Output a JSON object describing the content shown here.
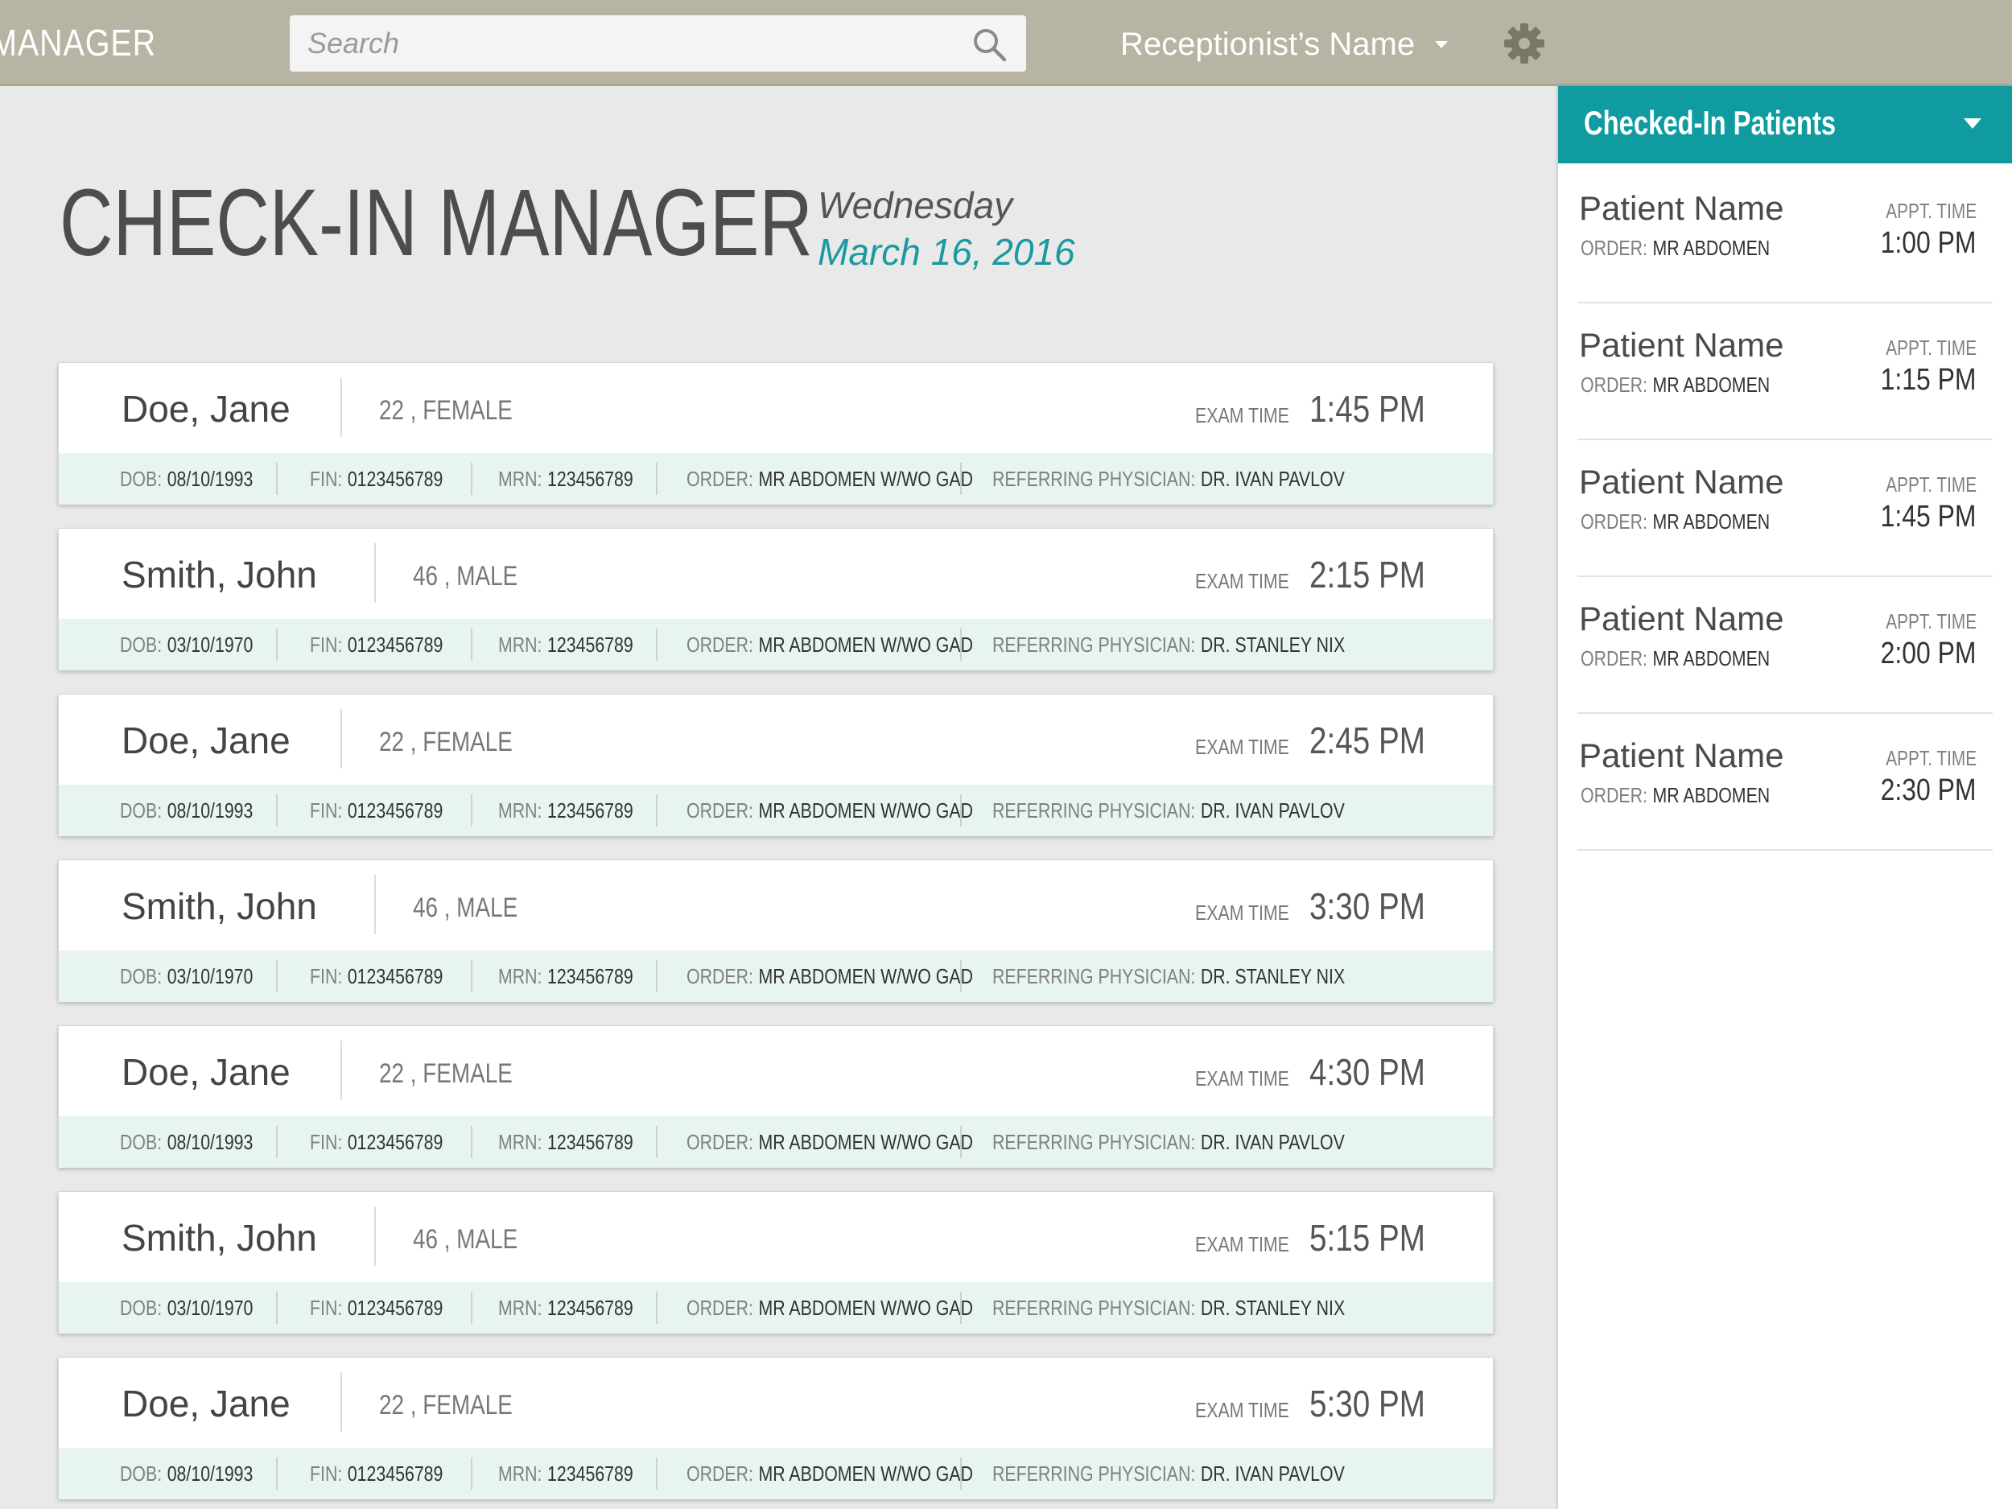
{
  "header": {
    "app_title": "MANAGER",
    "search_placeholder": "Search",
    "user_name": "Receptionist’s Name"
  },
  "page": {
    "title": "CHECK-IN MANAGER",
    "weekday": "Wednesday",
    "date": "March 16, 2016"
  },
  "labels": {
    "exam_time": "EXAM TIME",
    "dob": "DOB:",
    "fin": "FIN:",
    "mrn": "MRN:",
    "order": "ORDER:",
    "referring": "REFERRING PHYSICIAN:",
    "appt_time": "APPT. TIME"
  },
  "patients": [
    {
      "name": "Doe, Jane",
      "demo": "22 , FEMALE",
      "exam_time": "1:45 PM",
      "dob": "08/10/1993",
      "fin": "0123456789",
      "mrn": "123456789",
      "order": "MR ABDOMEN W/WO GAD",
      "physician": "DR. IVAN PAVLOV"
    },
    {
      "name": "Smith, John",
      "demo": "46 , MALE",
      "exam_time": "2:15 PM",
      "dob": "03/10/1970",
      "fin": "0123456789",
      "mrn": "123456789",
      "order": "MR ABDOMEN W/WO GAD",
      "physician": "DR. STANLEY NIX"
    },
    {
      "name": "Doe, Jane",
      "demo": "22 , FEMALE",
      "exam_time": "2:45 PM",
      "dob": "08/10/1993",
      "fin": "0123456789",
      "mrn": "123456789",
      "order": "MR ABDOMEN W/WO GAD",
      "physician": "DR. IVAN PAVLOV"
    },
    {
      "name": "Smith, John",
      "demo": "46 , MALE",
      "exam_time": "3:30 PM",
      "dob": "03/10/1970",
      "fin": "0123456789",
      "mrn": "123456789",
      "order": "MR ABDOMEN W/WO GAD",
      "physician": "DR. STANLEY NIX"
    },
    {
      "name": "Doe, Jane",
      "demo": "22 , FEMALE",
      "exam_time": "4:30 PM",
      "dob": "08/10/1993",
      "fin": "0123456789",
      "mrn": "123456789",
      "order": "MR ABDOMEN W/WO GAD",
      "physician": "DR. IVAN PAVLOV"
    },
    {
      "name": "Smith, John",
      "demo": "46 , MALE",
      "exam_time": "5:15 PM",
      "dob": "03/10/1970",
      "fin": "0123456789",
      "mrn": "123456789",
      "order": "MR ABDOMEN W/WO GAD",
      "physician": "DR. STANLEY NIX"
    },
    {
      "name": "Doe, Jane",
      "demo": "22 , FEMALE",
      "exam_time": "5:30 PM",
      "dob": "08/10/1993",
      "fin": "0123456789",
      "mrn": "123456789",
      "order": "MR ABDOMEN W/WO GAD",
      "physician": "DR. IVAN PAVLOV"
    }
  ],
  "checked_in": {
    "title": "Checked-In Patients",
    "items": [
      {
        "name": "Patient Name",
        "order": "MR ABDOMEN",
        "time": "1:00 PM"
      },
      {
        "name": "Patient Name",
        "order": "MR ABDOMEN",
        "time": "1:15 PM"
      },
      {
        "name": "Patient Name",
        "order": "MR ABDOMEN",
        "time": "1:45 PM"
      },
      {
        "name": "Patient Name",
        "order": "MR ABDOMEN",
        "time": "2:00 PM"
      },
      {
        "name": "Patient Name",
        "order": "MR ABDOMEN",
        "time": "2:30 PM"
      }
    ]
  },
  "colors": {
    "topbar": "#b7b4a3",
    "accent_teal": "#0f9b9f",
    "card_detail_bg": "#e8f4f2"
  },
  "icons": {
    "search": "search-icon",
    "user_menu": "chevron-down-icon",
    "settings": "gear-icon",
    "panel_toggle": "caret-down-icon"
  }
}
